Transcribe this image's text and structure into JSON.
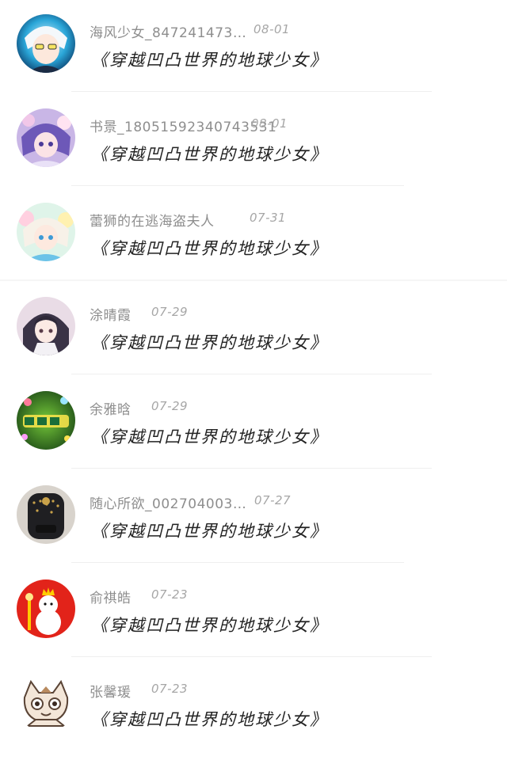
{
  "comments": [
    {
      "user": "海风少女_847241473…",
      "date": "08-01",
      "text": "《穿越凹凸世界的地球少女》",
      "avatar_icon": "anime-boy-avatar-icon"
    },
    {
      "user": "书景_1805159234074353​1",
      "date": "08-01",
      "text": "《穿越凹凸世界的地球少女》",
      "avatar_icon": "purple-hair-anime-avatar-icon"
    },
    {
      "user": "蕾狮的在逃海盗夫人",
      "date": "07-31",
      "text": "《穿越凹凸世界的地球少女》",
      "avatar_icon": "pastel-anime-avatar-icon"
    },
    {
      "user": "涂晴霞",
      "date": "07-29",
      "text": "《穿越凹凸世界的地球少女》",
      "avatar_icon": "dark-hair-girl-avatar-icon"
    },
    {
      "user": "余雅晗",
      "date": "07-29",
      "text": "《穿越凹凸世界的地球少女》",
      "avatar_icon": "green-youth-text-avatar-icon"
    },
    {
      "user": "随心所欲_002704003…",
      "date": "07-27",
      "text": "《穿越凹凸世界的地球少女》",
      "avatar_icon": "black-backpack-avatar-icon"
    },
    {
      "user": "俞祺皓",
      "date": "07-23",
      "text": "《穿越凹凸世界的地球少女》",
      "avatar_icon": "snowman-mascot-avatar-icon"
    },
    {
      "user": "张馨瑗",
      "date": "07-23",
      "text": "《穿越凹凸世界的地球少女》",
      "avatar_icon": "cartoon-cat-avatar-icon"
    }
  ],
  "colors": {
    "background": "#ffffff",
    "username": "#8e8e8e",
    "date": "#a6a6a6",
    "text": "#222222",
    "divider": "#efefef"
  }
}
